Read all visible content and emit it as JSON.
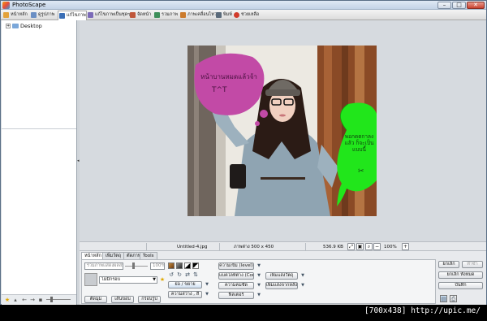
{
  "window": {
    "title": "PhotoScape",
    "controls": {
      "minimize": "–",
      "maximize": "□",
      "close": "✕"
    }
  },
  "tabs": [
    {
      "label": "หน้าหลัก",
      "icon": "home-icon",
      "color": "#e3a23b"
    },
    {
      "label": "ดูรูปภาพ",
      "icon": "viewer-icon",
      "color": "#6b8fc4"
    },
    {
      "label": "แก้ไขภาพ",
      "icon": "editor-icon",
      "color": "#3b6fb6",
      "active": true
    },
    {
      "label": "แก้ไขภาพเป็นชุดๆ",
      "icon": "batch-icon",
      "color": "#7c6bb8"
    },
    {
      "label": "จัดหน้า",
      "icon": "page-icon",
      "color": "#c0573a"
    },
    {
      "label": "รวมภาพ",
      "icon": "combine-icon",
      "color": "#3e8f5a"
    },
    {
      "label": "ภาพเคลื่อนไหว",
      "icon": "animated-gif-icon",
      "color": "#cc7b2c"
    },
    {
      "label": "พิมพ์",
      "icon": "print-icon",
      "color": "#5a6a7a"
    },
    {
      "label": "ช่วยเหลือ",
      "icon": "help-icon",
      "color": "#d13b2b"
    }
  ],
  "tree": {
    "root_label": "Desktop",
    "expander": "+"
  },
  "photo": {
    "bubble_left_text": "หน้าบานหมดแล้วจ้า",
    "bubble_left_face": "T^T",
    "bubble_right_text": "พอกดตกาลงแล้ว ก็จะเป็นแบบนี้",
    "bubble_right_glyph": "✂",
    "colors": {
      "magenta": "#c24aa6",
      "green": "#21e61b"
    }
  },
  "status": {
    "filename": "Untitled-4.jpg",
    "dimensions": "ภาพต่าง 500 x 450",
    "filesize": "536.9 KB",
    "zoom": "100%"
  },
  "editor": {
    "subtabs": [
      "หน้าหลัก",
      "เพิ่มวัตถุ",
      "ตัดภาพ",
      "Tools"
    ],
    "adjust_label": "รวมภาพแสดงผลสม",
    "zoom_field": "100%",
    "frame_select": "ไม่มีกรอบ",
    "buttons": {
      "resize": "ย่อ / ขยาย",
      "brightness": "ความสว่าง , สี",
      "levels": "ความเข้ม (level)",
      "sharpen": "ความคมชัด",
      "filter": "ฟิลเตอร์",
      "backlight": "แบคไลท์ต่าง (Contra",
      "add_object": "เพิ่มแสงวัตถุ",
      "add_bg": "เพิ่มแสงจากหลัง",
      "round": "ตัดมุม",
      "shape": "เส้นขอบ",
      "crop": "กรอบรูป"
    },
    "right_buttons": {
      "undo": "ยกเลิก",
      "redo": "ทำซ้ำ",
      "undo_all": "ยกเลิก ทั้งหมด",
      "save": "บันทึก"
    }
  },
  "caption": "[700x438] http://upic.me/"
}
